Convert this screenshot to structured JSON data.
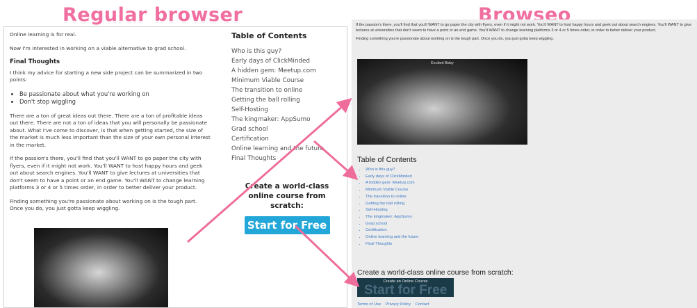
{
  "headings": {
    "left": "Regular browser",
    "right": "Browseo"
  },
  "regular": {
    "paragraphs_top": [
      "Online learning is for real.",
      "Now I'm interested in working on a viable alternative to grad school."
    ],
    "final_heading": "Final Thoughts",
    "intro": "I think my advice for starting a new side project can be summarized in two points:",
    "bullets": [
      "Be passionate about what you're working on",
      "Don't stop wiggling"
    ],
    "para_ideas": "There are a ton of great ideas out there. There are a ton of profitable ideas out there. There are not a ton of ideas that you will personally be passionate about. What I've come to discover, is that when getting started, the size of the market is much less important than the size of your own personal interest in the market.",
    "para_passion": "If the passion's there, you'll find that you'll WANT to go paper the city with flyers, even if it might not work. You'll WANT to host happy hours and geek out about search engines. You'll WANT to give lectures at universities that don't seem to have a point or an end game. You'll WANT to change learning platforms 3 or 4 or 5 times order, in order to better deliver your product.",
    "para_finding": "Finding something you're passionate about working on is the tough part. Once you do, you just gotta keep wiggling.",
    "toc_title": "Table of Contents",
    "toc": [
      "Who is this guy?",
      "Early days of ClickMinded",
      "A hidden gem: Meetup.com",
      "Minimum Viable Course",
      "The transition to online",
      "Getting the ball rolling",
      "Self-Hosting",
      "The kingmaker: AppSumo",
      "Grad school",
      "Certification",
      "Online learning and the future",
      "Final Thoughts"
    ],
    "cta_text": "Create a world-class online course from scratch:",
    "cta_button": "Start for Free"
  },
  "browseo": {
    "para_passion": "If the passion's there, you'll find that you'll WANT to go paper the city with flyers, even if it might not work. You'll WANT to host happy hours and geek out about search engines. You'll WANT to give lectures at universities that don't seem to have a point or an end game. You'll WANT to change learning platforms 3 or 4 or 5 times order, in order to better deliver your product.",
    "para_finding": "Finding something you're passionate about working on is the tough part. Once you do, you just gotta keep wiggling.",
    "image_caption": "Excited Baby",
    "toc_title": "Table of Contents",
    "toc": [
      "Who is this guy?",
      "Early days of ClickMinded",
      "A hidden gem: Meetup.com",
      "Minimum Viable Course",
      "The transition to online",
      "Getting the ball rolling",
      "Self-Hosting",
      "The kingmaker: AppSumo",
      "Grad school",
      "Certification",
      "Online learning and the future",
      "Final Thoughts"
    ],
    "cta_text": "Create a world-class online course from scratch:",
    "button_ghost": "Start for Free",
    "button_overlay": "Create an Online Course",
    "footer": [
      "Terms of Use",
      "Privacy Policy",
      "Contact"
    ]
  },
  "colors": {
    "heading": "#f06fa0",
    "arrow": "#ef6d9b",
    "button_blue": "#22a7d8",
    "link_blue": "#3a77c6"
  }
}
